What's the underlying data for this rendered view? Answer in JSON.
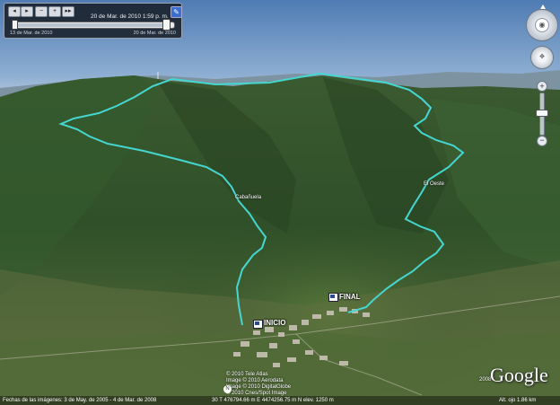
{
  "time_slider": {
    "current_date": "20 de Mar. de 2010    1:59 p. m.",
    "start_date": "13 de Mar. de 2010",
    "end_date": "20 de Mar. de 2010"
  },
  "map": {
    "labels": {
      "inicio": "INICIO",
      "final": "FINAL",
      "waypoint_left": "Cabañuela",
      "waypoint_right": "El Oeste"
    },
    "copyright_lines": [
      "© 2010 Tele Atlas",
      "Image © 2010 Aerodata",
      "Image © 2010 DigitalGlobe",
      "© 2010 Cnes/Spot Image"
    ],
    "google_logo": "Google",
    "logo_year": "2008",
    "track_color": "#46d6d0"
  },
  "status_bar": {
    "imagery_dates": "Fechas de las imágenes: 3 de May. de 2005 - 4 de Mar. de 2008",
    "coordinates": "30 T 476794.66 m E 4474256.75 m N  elev. 1250 m",
    "eye_altitude": "Alt. ojo    1.86 km"
  },
  "nav": {
    "north_label": "N",
    "zoom_plus": "+",
    "zoom_minus": "−"
  }
}
